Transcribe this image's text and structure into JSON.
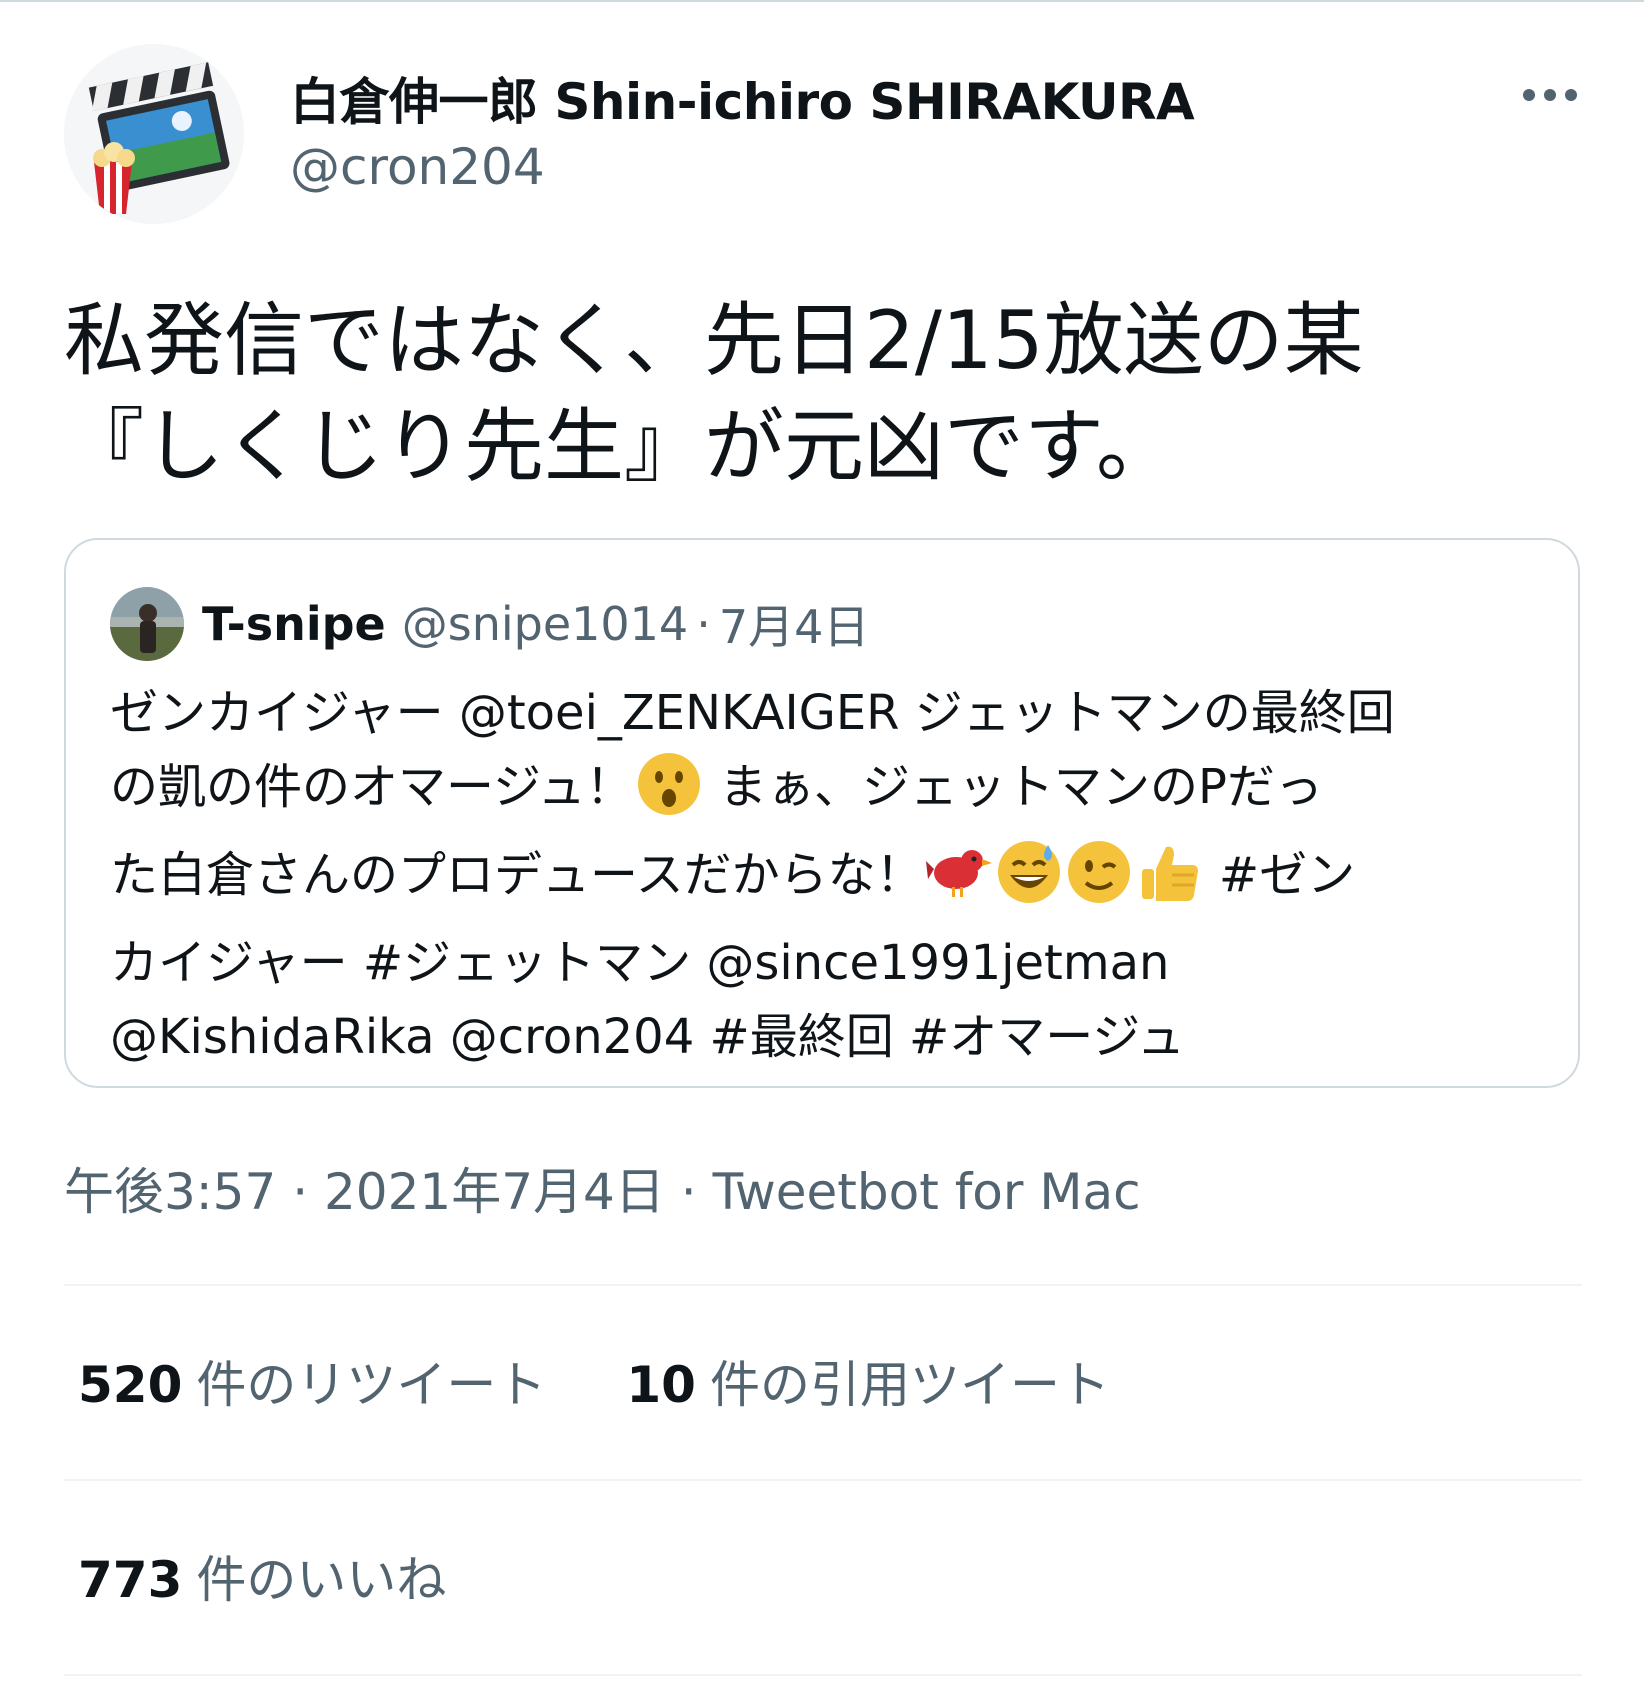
{
  "tweet": {
    "author": {
      "display_name": "白倉伸一郎 Shin-ichiro SHIRAKURA",
      "handle": "@cron204",
      "avatar_icon": "clapperboard-popcorn-icon"
    },
    "more_icon": "more-horizontal-icon",
    "text_lines": [
      "私発信ではなく、先日2/15放送の某",
      "『しくじり先生』が元凶です。"
    ],
    "quote": {
      "name": "T-snipe",
      "handle": "@snipe1014",
      "separator": "·",
      "date": "7月4日",
      "lines": {
        "l1": "ゼンカイジャー @toei_ZENKAIGER ジェットマンの最終回",
        "l2a": "の凱の件のオマージュ！",
        "l2b": "まぁ、ジェットマンのPだっ",
        "l3a": "た白倉さんのプロデュースだからな！",
        "l3b": "#ゼン",
        "l4": "カイジャー #ジェットマン @since1991jetman",
        "l5": "@KishidaRika @cron204 #最終回 #オマージュ"
      },
      "emojis": [
        "astonished-face-emoji",
        "red-bird-emoji",
        "grinning-sweat-emoji",
        "winking-face-emoji",
        "thumbs-up-emoji"
      ]
    },
    "meta": {
      "time": "午後3:57",
      "sep": "·",
      "date": "2021年7月4日",
      "source": "Tweetbot for Mac"
    },
    "stats": {
      "retweets_count": "520",
      "retweets_label": "件のリツイート",
      "quotes_count": "10",
      "quotes_label": "件の引用ツイート",
      "likes_count": "773",
      "likes_label": "件のいいね"
    },
    "colors": {
      "text": "#0f1419",
      "secondary": "#536471",
      "border": "#cfd9de",
      "divider": "#eff3f4"
    }
  }
}
